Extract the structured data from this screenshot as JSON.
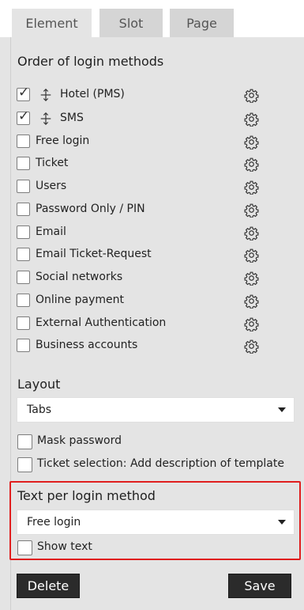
{
  "tabs": [
    {
      "label": "Element",
      "active": true
    },
    {
      "label": "Slot",
      "active": false
    },
    {
      "label": "Page",
      "active": false
    }
  ],
  "order_section": {
    "title": "Order of login methods",
    "methods": [
      {
        "label": "Hotel (PMS)",
        "checked": true,
        "draggable": true
      },
      {
        "label": "SMS",
        "checked": true,
        "draggable": true
      },
      {
        "label": "Free login",
        "checked": false,
        "draggable": false
      },
      {
        "label": "Ticket",
        "checked": false,
        "draggable": false
      },
      {
        "label": "Users",
        "checked": false,
        "draggable": false
      },
      {
        "label": "Password Only / PIN",
        "checked": false,
        "draggable": false
      },
      {
        "label": "Email",
        "checked": false,
        "draggable": false
      },
      {
        "label": "Email Ticket-Request",
        "checked": false,
        "draggable": false
      },
      {
        "label": "Social networks",
        "checked": false,
        "draggable": false
      },
      {
        "label": "Online payment",
        "checked": false,
        "draggable": false
      },
      {
        "label": "External Authentication",
        "checked": false,
        "draggable": false
      },
      {
        "label": "Business accounts",
        "checked": false,
        "draggable": false
      }
    ]
  },
  "layout_section": {
    "title": "Layout",
    "selected": "Tabs",
    "mask_password_label": "Mask password",
    "mask_password_checked": false,
    "ticket_selection_label": "Ticket selection: Add description of template",
    "ticket_selection_checked": false
  },
  "text_per_method_section": {
    "title": "Text per login method",
    "selected": "Free login",
    "show_text_label": "Show text",
    "show_text_checked": false
  },
  "actions": {
    "delete_label": "Delete",
    "save_label": "Save"
  },
  "colors": {
    "highlight_border": "#e01e1e",
    "button_bg": "#2b2b2b",
    "panel_bg": "#e4e4e4"
  },
  "icons": {
    "gear": "gear-icon",
    "drag": "drag-handle-icon",
    "caret": "chevron-down-icon"
  }
}
